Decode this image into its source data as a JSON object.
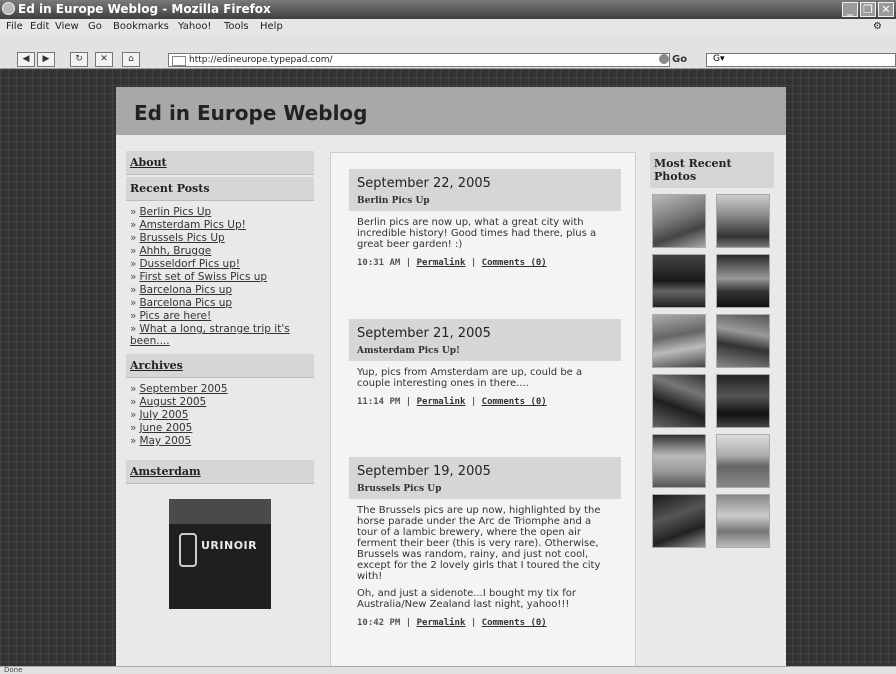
{
  "window": {
    "title": "Ed in Europe Weblog - Mozilla Firefox"
  },
  "menu": [
    "File",
    "Edit",
    "View",
    "Go",
    "Bookmarks",
    "Yahoo!",
    "Tools",
    "Help"
  ],
  "toolbar": {
    "url": "http://edineurope.typepad.com/",
    "go_label": "Go",
    "search_engine": "G▾"
  },
  "blog": {
    "title": "Ed in Europe Weblog"
  },
  "sidebar": {
    "about": "About",
    "recent_posts_heading": "Recent Posts",
    "recent_posts": [
      "Berlin Pics Up",
      "Amsterdam Pics Up!",
      "Brussels Pics Up",
      "Ahhh, Brugge",
      "Dusseldorf Pics up!",
      "First set of Swiss Pics up",
      "Barcelona Pics up",
      "Barcelona Pics up",
      "Pics are here!",
      "What a long, strange trip it's been...."
    ],
    "archives_heading": "Archives",
    "archives": [
      "September 2005",
      "August 2005",
      "July 2005",
      "June 2005",
      "May 2005"
    ],
    "amsterdam_heading": "Amsterdam",
    "amsterdam_image_text": "URINOIR"
  },
  "posts": [
    {
      "date": "September 22, 2005",
      "title": "Berlin Pics Up",
      "body": [
        "Berlin pics are now up, what a great city with incredible history! Good times had there, plus a great beer garden! :)"
      ],
      "time": "10:31 AM",
      "permalink": "Permalink",
      "comments": "Comments (0)"
    },
    {
      "date": "September 21, 2005",
      "title": "Amsterdam Pics Up!",
      "body": [
        "Yup, pics from Amsterdam are up, could be a couple interesting ones in there...."
      ],
      "time": "11:14 PM",
      "permalink": "Permalink",
      "comments": "Comments (0)"
    },
    {
      "date": "September 19, 2005",
      "title": "Brussels Pics Up",
      "body": [
        "The Brussels pics are up now, highlighted by the horse parade under the Arc de Triomphe and a tour of a lambic brewery, where the open air ferment their beer (this is very rare). Otherwise, Brussels was random, rainy, and just not cool, except for the 2 lovely girls that I toured the city with!",
        "Oh, and just a sidenote...I bought my tix for Australia/New Zealand last night, yahoo!!!"
      ],
      "time": "10:42 PM",
      "permalink": "Permalink",
      "comments": "Comments (0)"
    }
  ],
  "photos": {
    "heading": "Most Recent Photos",
    "count": 12
  },
  "statusbar": {
    "text": "Done"
  }
}
